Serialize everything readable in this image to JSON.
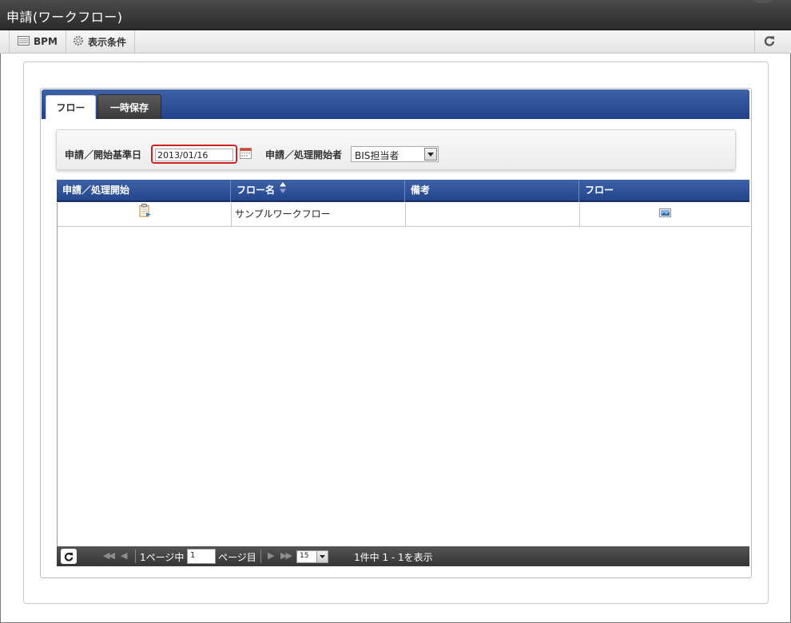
{
  "window": {
    "title": "申請(ワークフロー)"
  },
  "toolbar": {
    "bpm_label": "BPM",
    "conditions_label": "表示条件"
  },
  "tabs": [
    {
      "label": "フロー",
      "active": true
    },
    {
      "label": "一時保存",
      "active": false
    }
  ],
  "search": {
    "base_date_label": "申請／開始基準日",
    "base_date_value": "2013/01/16",
    "operator_label": "申請／処理開始者",
    "operator_value": "BIS担当者"
  },
  "grid": {
    "columns": [
      "申請／処理開始",
      "フロー名",
      "備考",
      "フロー"
    ],
    "sort_column": "フロー名",
    "rows": [
      {
        "start_icon": "clipboard-icon",
        "flow_name": "サンプルワークフロー",
        "remarks": "",
        "flow_icon": "flow-image-icon"
      }
    ]
  },
  "pager": {
    "page_prefix": "1ページ中",
    "page_value": "1",
    "page_suffix": "ページ目",
    "rows_per_page": "15",
    "summary": "1件中 1 - 1を表示"
  },
  "colors": {
    "header_blue": "#2f5299",
    "highlight_red": "#d12020",
    "titlebar_dark": "#333333"
  }
}
